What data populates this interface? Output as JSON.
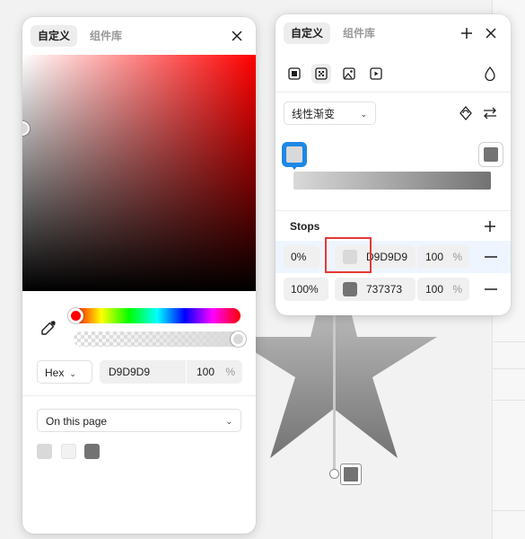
{
  "colors": {
    "accent": "#1e88e5",
    "stop_start": "#D9D9D9",
    "stop_end": "#737373",
    "annotation": "#e53935"
  },
  "color_picker": {
    "tabs": [
      {
        "label": "自定义",
        "active": true
      },
      {
        "label": "组件库",
        "active": false
      }
    ],
    "close_icon": "close-icon",
    "eyedropper_icon": "eyedropper-icon",
    "format": "Hex",
    "hex_value": "D9D9D9",
    "opacity": "100",
    "opacity_unit": "%",
    "library_dropdown": "On this page",
    "page_swatches": [
      "#D9D9D9",
      "#F2F2F2",
      "#737373"
    ]
  },
  "fill_panel": {
    "tabs": [
      {
        "label": "自定义",
        "active": true
      },
      {
        "label": "组件库",
        "active": false
      }
    ],
    "add_icon": "plus-icon",
    "close_icon": "close-icon",
    "fill_types": [
      "solid-icon",
      "gradient-icon",
      "image-icon",
      "video-icon"
    ],
    "active_fill_type": "gradient-icon",
    "blend_icon": "drop-icon",
    "gradient_type": "线性渐变",
    "rotate_icon": "rotate-icon",
    "swap_icon": "swap-icon",
    "stops_title": "Stops",
    "add_stop_icon": "plus-icon",
    "stops": [
      {
        "position": "0%",
        "color": "#D9D9D9",
        "hex": "D9D9D9",
        "opacity": "100",
        "unit": "%",
        "selected": true
      },
      {
        "position": "100%",
        "color": "#737373",
        "hex": "737373",
        "opacity": "100",
        "unit": "%",
        "selected": false
      }
    ],
    "remove_icon": "minus-icon"
  }
}
